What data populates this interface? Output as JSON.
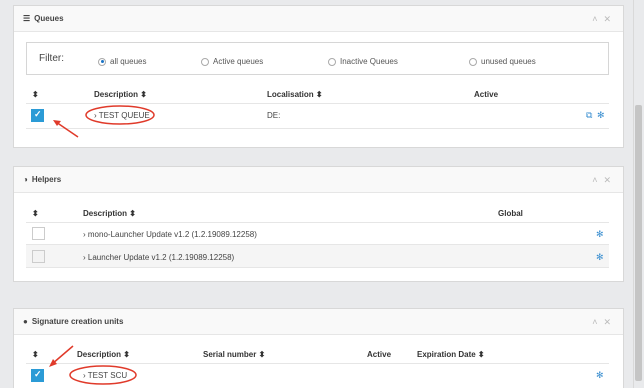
{
  "queues": {
    "title": "Queues",
    "filter": {
      "label": "Filter:",
      "options": [
        "all queues",
        "Active queues",
        "Inactive Queues",
        "unused queues"
      ],
      "selected": "all queues"
    },
    "columns": {
      "sort": "⬍",
      "description": "Description ⬍",
      "localisation": "Localisation ⬍",
      "active": "Active"
    },
    "rows": [
      {
        "description": "› TEST QUEUE",
        "localisation": "DE:",
        "checked": true
      }
    ]
  },
  "helpers": {
    "title": "Helpers",
    "columns": {
      "sort": "⬍",
      "description": "Description ⬍",
      "global": "Global"
    },
    "rows": [
      {
        "description": "› mono-Launcher Update v1.2 (1.2.19089.12258)",
        "checked": false
      },
      {
        "description": "› Launcher Update v1.2 (1.2.19089.12258)",
        "checked": false
      }
    ]
  },
  "scu": {
    "title": "Signature creation units",
    "columns": {
      "sort": "⬍",
      "description": "Description ⬍",
      "serial": "Serial number ⬍",
      "active": "Active",
      "expiration": "Expiration Date ⬍"
    },
    "rows": [
      {
        "description": "› TEST SCU",
        "checked": true
      }
    ]
  },
  "icons": {
    "collapse": "chevron-up-icon",
    "close": "close-icon",
    "gear": "gear-icon",
    "external": "external-link-icon"
  },
  "colors": {
    "accent": "#2b9bd6",
    "annotation": "#e03a2a"
  }
}
